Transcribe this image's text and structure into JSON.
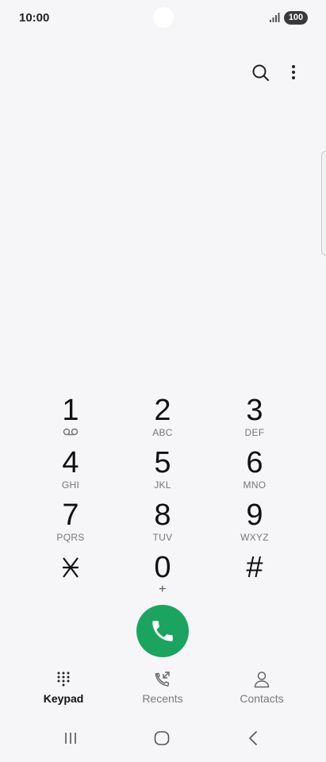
{
  "status_bar": {
    "time": "10:00",
    "battery": "100",
    "signal_icon": "signal-bars-icon"
  },
  "toolbar": {
    "search_icon": "search-icon",
    "more_icon": "more-options-icon"
  },
  "keypad": {
    "keys": [
      {
        "digit": "1",
        "letters": ""
      },
      {
        "digit": "2",
        "letters": "ABC"
      },
      {
        "digit": "3",
        "letters": "DEF"
      },
      {
        "digit": "4",
        "letters": "GHI"
      },
      {
        "digit": "5",
        "letters": "JKL"
      },
      {
        "digit": "6",
        "letters": "MNO"
      },
      {
        "digit": "7",
        "letters": "PQRS"
      },
      {
        "digit": "8",
        "letters": "TUV"
      },
      {
        "digit": "9",
        "letters": "WXYZ"
      },
      {
        "digit": "⁎",
        "letters": ""
      },
      {
        "digit": "0",
        "letters": "+"
      },
      {
        "digit": "#",
        "letters": ""
      }
    ]
  },
  "call_button": {
    "icon": "phone-icon",
    "color": "#1aa460"
  },
  "tabs": [
    {
      "label": "Keypad",
      "icon": "keypad-icon",
      "active": true
    },
    {
      "label": "Recents",
      "icon": "recents-icon",
      "active": false
    },
    {
      "label": "Contacts",
      "icon": "contacts-icon",
      "active": false
    }
  ],
  "nav_bar": {
    "recent_apps_icon": "recent-apps-icon",
    "home_icon": "home-icon",
    "back_icon": "back-icon"
  }
}
